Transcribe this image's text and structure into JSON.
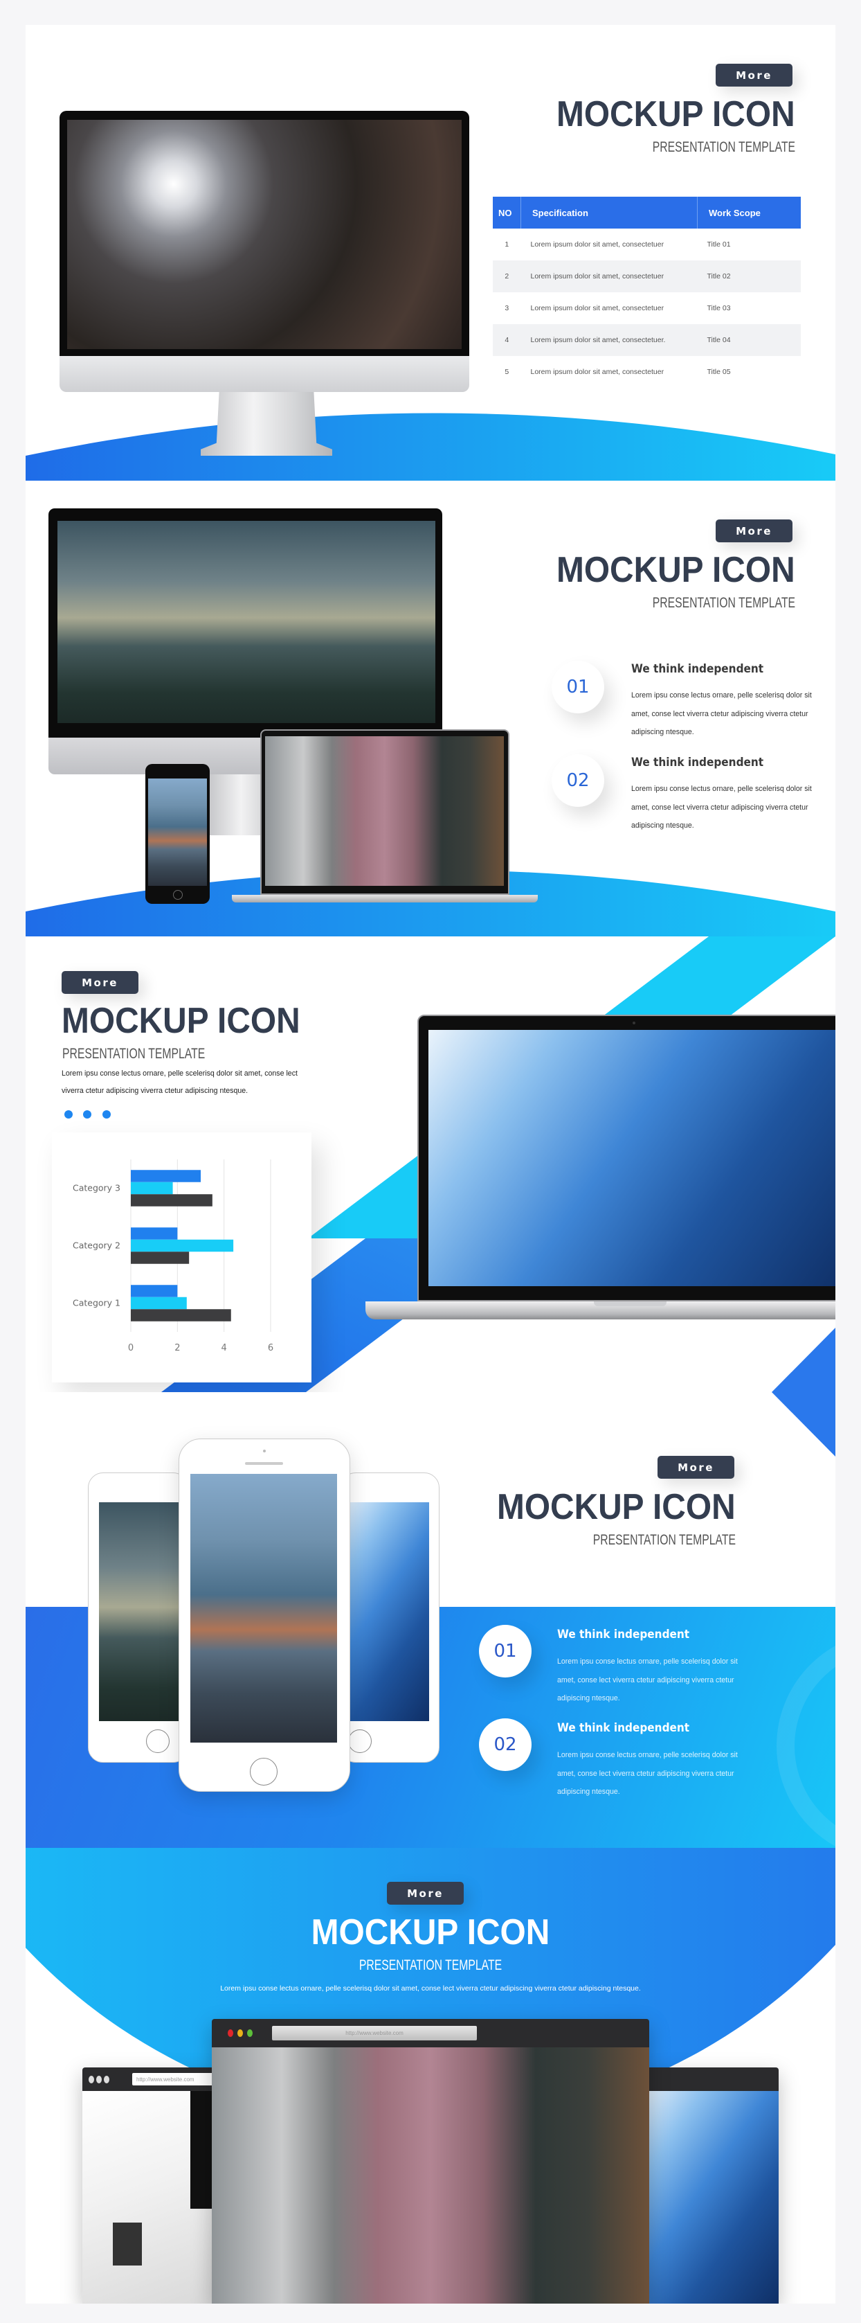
{
  "colors": {
    "brand_dark": "#353e50",
    "title": "#333d4f",
    "accent_blue": "#2a6ee8",
    "accent_cyan": "#18c8f6",
    "bar_dark": "#3d3d3f"
  },
  "slide1": {
    "more": "More",
    "title": "MOCKUP ICON",
    "subtitle": "PRESENTATION TEMPLATE",
    "table": {
      "headers": [
        "NO",
        "Specification",
        "Work Scope"
      ],
      "rows": [
        [
          "1",
          "Lorem ipsum dolor sit amet, consectetuer",
          "Title 01"
        ],
        [
          "2",
          "Lorem ipsum dolor sit amet, consectetuer",
          "Title 02"
        ],
        [
          "3",
          "Lorem ipsum dolor sit amet, consectetuer",
          "Title 03"
        ],
        [
          "4",
          "Lorem ipsum dolor sit amet, consectetuer.",
          "Title 04"
        ],
        [
          "5",
          "Lorem ipsum dolor sit amet, consectetuer",
          "Title 05"
        ]
      ]
    }
  },
  "slide2": {
    "more": "More",
    "title": "MOCKUP ICON",
    "subtitle": "PRESENTATION TEMPLATE",
    "items": [
      {
        "num": "01",
        "heading": "We think independent",
        "text": "Lorem ipsu conse lectus ornare, pelle scelerisq dolor sit amet, conse lect viverra ctetur adipiscing viverra ctetur adipiscing ntesque."
      },
      {
        "num": "02",
        "heading": "We think independent",
        "text": "Lorem ipsu conse lectus ornare, pelle scelerisq dolor sit amet, conse lect viverra ctetur adipiscing viverra ctetur adipiscing ntesque."
      }
    ]
  },
  "slide3": {
    "more": "More",
    "title": "MOCKUP ICON",
    "subtitle": "PRESENTATION TEMPLATE",
    "paragraph": "Lorem ipsu conse lectus ornare, pelle scelerisq dolor sit amet, conse lect viverra ctetur adipiscing viverra ctetur adipiscing ntesque."
  },
  "slide4": {
    "more": "More",
    "title": "MOCKUP ICON",
    "subtitle": "PRESENTATION TEMPLATE",
    "items": [
      {
        "num": "01",
        "heading": "We think independent",
        "text": "Lorem ipsu conse lectus ornare, pelle scelerisq dolor sit amet, conse lect viverra ctetur adipiscing viverra ctetur adipiscing ntesque."
      },
      {
        "num": "02",
        "heading": "We think independent",
        "text": "Lorem ipsu conse lectus ornare, pelle scelerisq dolor sit amet, conse lect viverra ctetur adipiscing viverra ctetur adipiscing ntesque."
      }
    ]
  },
  "slide5": {
    "more": "More",
    "title": "MOCKUP ICON",
    "subtitle": "PRESENTATION TEMPLATE",
    "paragraph": "Lorem ipsu conse lectus ornare, pelle scelerisq dolor sit amet, conse lect viverra ctetur adipiscing viverra ctetur adipiscing ntesque.",
    "browser_url": "http://www.website.com"
  },
  "chart_data": {
    "type": "bar",
    "orientation": "horizontal",
    "categories": [
      "Category 1",
      "Category 2",
      "Category 3"
    ],
    "series": [
      {
        "color": "#2080ee",
        "values": [
          2,
          2,
          3
        ]
      },
      {
        "color": "#18cdf7",
        "values": [
          2.4,
          4.4,
          1.8
        ]
      },
      {
        "color": "#3d3d3f",
        "values": [
          4.3,
          2.5,
          3.5
        ]
      }
    ],
    "xlim": [
      0,
      6
    ],
    "xticks": [
      "0",
      "2",
      "4",
      "6"
    ],
    "grid": true,
    "legend": "none"
  }
}
